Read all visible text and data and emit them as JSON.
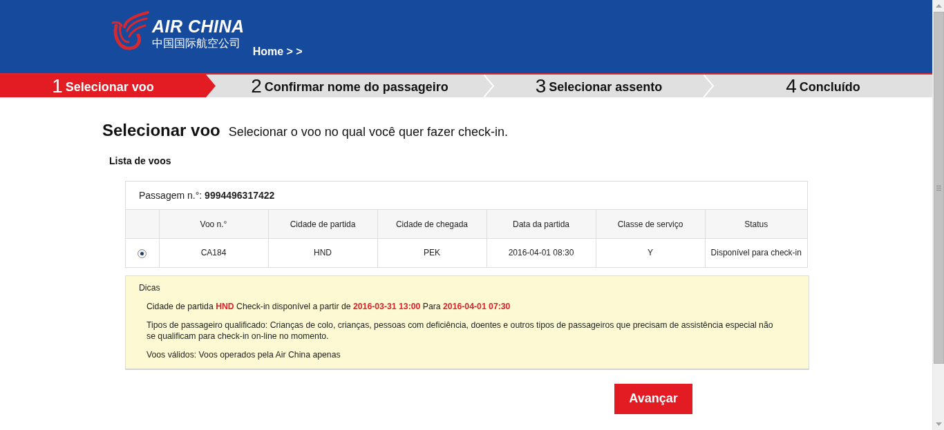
{
  "header": {
    "logo": {
      "wordmark": "AIR CHINA",
      "chinese_name": "中国国际航空公司"
    },
    "breadcrumb": "Home > >"
  },
  "steps": [
    {
      "number": "1",
      "label": "Selecionar voo",
      "selected": true
    },
    {
      "number": "2",
      "label": "Confirmar nome do passageiro",
      "selected": false
    },
    {
      "number": "3",
      "label": "Selecionar assento",
      "selected": false
    },
    {
      "number": "4",
      "label": "Concluído",
      "selected": false
    }
  ],
  "page": {
    "title": "Selecionar voo",
    "subtitle": "Selecionar o voo no qual você quer fazer check-in."
  },
  "flight_list": {
    "title": "Lista de voos",
    "ticket": "Passagem n.°: **9994496317422**",
    "columns": [
      "Voo n.°",
      "Cidade de partida",
      "Cidade de chegada",
      "Data da partida",
      "Classe de serviço",
      "Status"
    ],
    "rows": [
      {
        "selected": true,
        "cells": [
          "CA184",
          "HND",
          "PEK",
          "2016-04-01 08:30",
          "Y",
          "Disponível para check-in"
        ]
      }
    ]
  },
  "tips": {
    "title": "Dicas",
    "items": [
      "Cidade de partida **HND** Check-in disponível a partir de **2016-03-31 13:00** Para **2016-04-01 07:30**",
      "Tipos de passageiro qualificado: Crianças de colo, crianças, pessoas com deficiência, doentes e outros tipos de passageiros que precisam de assistência especial não se qualificam para check-in on-line no momento.",
      "Voos válidos: Voos operados pela Air China apenas"
    ]
  },
  "next_button": "Avançar"
}
